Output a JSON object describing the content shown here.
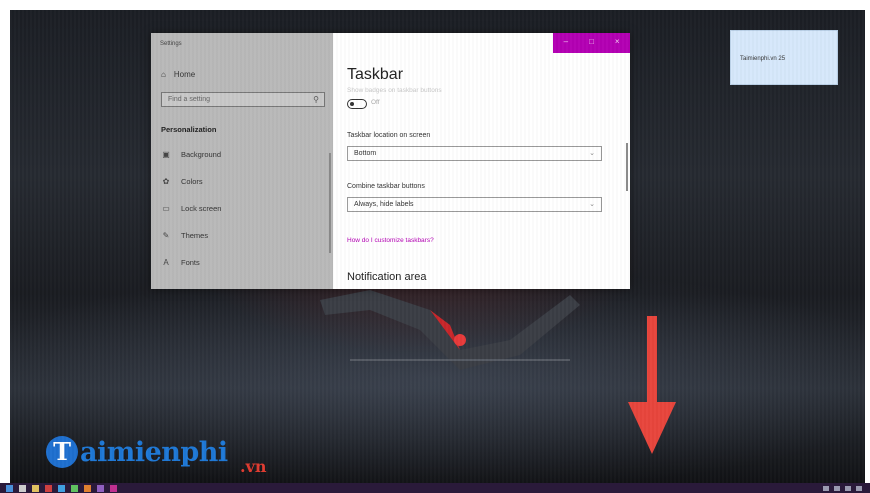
{
  "settings": {
    "window_title": "Settings",
    "home_label": "Home",
    "search_placeholder": "Find a setting",
    "section_label": "Personalization",
    "nav_items": [
      {
        "label": "Background"
      },
      {
        "label": "Colors"
      },
      {
        "label": "Lock screen"
      },
      {
        "label": "Themes"
      },
      {
        "label": "Fonts"
      }
    ],
    "titlebar": {
      "minimize": "–",
      "maximize": "□",
      "close": "×"
    },
    "page_title": "Taskbar",
    "badges_label": "Show badges on taskbar buttons",
    "badges_toggle_state": "Off",
    "location_label": "Taskbar location on screen",
    "location_value": "Bottom",
    "combine_label": "Combine taskbar buttons",
    "combine_value": "Always, hide labels",
    "help_link": "How do I customize taskbars?",
    "notification_heading": "Notification area"
  },
  "notification": {
    "text": "Taimienphi.vn 25"
  },
  "logo": {
    "mark": "T",
    "text": "aimienphi",
    "suffix": ".vn"
  },
  "colors": {
    "accent": "#b400b4",
    "sidebar_bg": "#b9b9b9",
    "arrow": "#e8453c",
    "logo_blue": "#1e78d6",
    "logo_red": "#e03a2f",
    "notification_bg": "#d6e8fb"
  }
}
